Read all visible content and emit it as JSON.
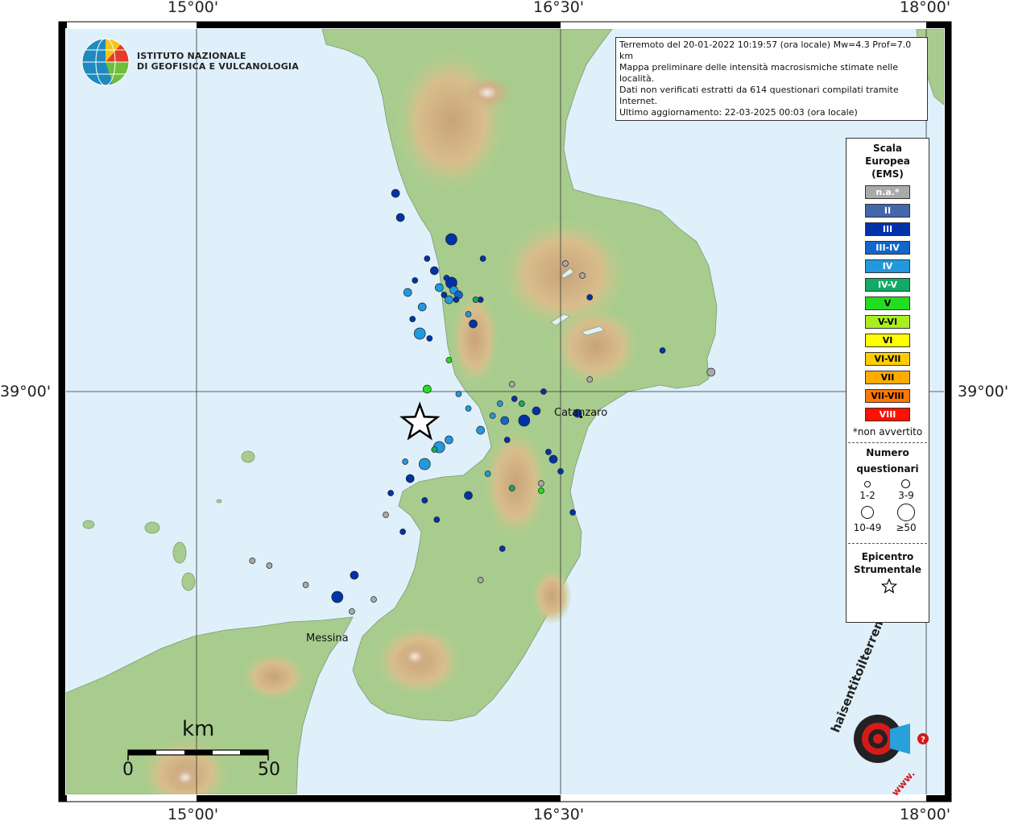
{
  "coords": {
    "top": [
      "15°00'",
      "16°30'",
      "18°00'"
    ],
    "bottom": [
      "15°00'",
      "16°30'",
      "18°00'"
    ],
    "left": "39°00'",
    "right": "39°00'"
  },
  "logo": {
    "line1": "ISTITUTO NAZIONALE",
    "line2": "DI GEOFISICA E VULCANOLOGIA"
  },
  "info": {
    "line1": "Terremoto del 20-01-2022 10:19:57 (ora locale) Mw=4.3 Prof=7.0 km",
    "line2": "Mappa preliminare delle intensità macrosismiche stimate nelle località.",
    "line3": "Dati non verificati estratti da 614 questionari compilati tramite Internet.",
    "line4": "Ultimo aggiornamento: 22-03-2025 00:03 (ora locale)"
  },
  "places": {
    "catanzaro": "Catanzaro",
    "messina": "Messina"
  },
  "legend": {
    "title1": "Scala",
    "title2": "Europea",
    "title3": "(EMS)",
    "scale": [
      {
        "label": "n.a.*",
        "color": "#aaaaaa",
        "text": "#ffffff"
      },
      {
        "label": "II",
        "color": "#4466aa",
        "text": "#ffffff"
      },
      {
        "label": "III",
        "color": "#0033aa",
        "text": "#ffffff"
      },
      {
        "label": "III-IV",
        "color": "#1166cc",
        "text": "#ffffff"
      },
      {
        "label": "IV",
        "color": "#2299dd",
        "text": "#ffffff"
      },
      {
        "label": "IV-V",
        "color": "#11aa66",
        "text": "#ffffff"
      },
      {
        "label": "V",
        "color": "#22dd22",
        "text": "#000000"
      },
      {
        "label": "V-VI",
        "color": "#aaee22",
        "text": "#000000"
      },
      {
        "label": "VI",
        "color": "#ffff00",
        "text": "#000000"
      },
      {
        "label": "VI-VII",
        "color": "#ffcc00",
        "text": "#000000"
      },
      {
        "label": "VII",
        "color": "#ffaa00",
        "text": "#000000"
      },
      {
        "label": "VII-VIII",
        "color": "#ff7700",
        "text": "#000000"
      },
      {
        "label": "VIII",
        "color": "#ff1100",
        "text": "#ffffff"
      }
    ],
    "note": "*non avvertito",
    "count_title1": "Numero",
    "count_title2": "questionari",
    "sizes": [
      "1-2",
      "3-9",
      "10-49",
      "≥50"
    ],
    "epi1": "Epicentro",
    "epi2": "Strumentale"
  },
  "scalebar": {
    "unit": "km",
    "min": "0",
    "max": "50"
  },
  "badge": {
    "text": "haisentitoilterremoto.it",
    "url": "www."
  },
  "colors": {
    "sea": "#dff0fa",
    "land": "#9fc88a",
    "mountain": "#c8a878",
    "frame": "#000000"
  },
  "points": [
    {
      "lon": 16.0,
      "lat": 39.43,
      "level": "IV",
      "n": "3-9"
    },
    {
      "lon": 16.05,
      "lat": 39.45,
      "level": "III",
      "n": "10-49"
    },
    {
      "lon": 16.02,
      "lat": 39.4,
      "level": "III",
      "n": "1-2"
    },
    {
      "lon": 16.06,
      "lat": 39.42,
      "level": "IV",
      "n": "3-9"
    },
    {
      "lon": 16.08,
      "lat": 39.4,
      "level": "III-IV",
      "n": "3-9"
    },
    {
      "lon": 16.04,
      "lat": 39.38,
      "level": "IV",
      "n": "3-9"
    },
    {
      "lon": 16.07,
      "lat": 39.38,
      "level": "III",
      "n": "1-2"
    },
    {
      "lon": 16.03,
      "lat": 39.47,
      "level": "III",
      "n": "1-2"
    },
    {
      "lon": 15.98,
      "lat": 39.5,
      "level": "III",
      "n": "3-9"
    },
    {
      "lon": 15.9,
      "lat": 39.46,
      "level": "III",
      "n": "1-2"
    },
    {
      "lon": 15.87,
      "lat": 39.41,
      "level": "IV",
      "n": "3-9"
    },
    {
      "lon": 15.89,
      "lat": 39.3,
      "level": "III",
      "n": "1-2"
    },
    {
      "lon": 15.93,
      "lat": 39.35,
      "level": "IV",
      "n": "3-9"
    },
    {
      "lon": 15.96,
      "lat": 39.22,
      "level": "III",
      "n": "1-2"
    },
    {
      "lon": 15.92,
      "lat": 39.24,
      "level": "IV",
      "n": "10-49"
    },
    {
      "lon": 16.14,
      "lat": 39.28,
      "level": "III",
      "n": "3-9"
    },
    {
      "lon": 16.12,
      "lat": 39.32,
      "level": "IV",
      "n": "1-2"
    },
    {
      "lon": 16.17,
      "lat": 39.38,
      "level": "III",
      "n": "1-2"
    },
    {
      "lon": 15.84,
      "lat": 39.72,
      "level": "III",
      "n": "3-9"
    },
    {
      "lon": 15.82,
      "lat": 39.82,
      "level": "III",
      "n": "3-9"
    },
    {
      "lon": 16.05,
      "lat": 39.63,
      "level": "III",
      "n": "10-49"
    },
    {
      "lon": 15.95,
      "lat": 39.55,
      "level": "III",
      "n": "1-2"
    },
    {
      "lon": 16.18,
      "lat": 39.55,
      "level": "III",
      "n": "1-2"
    },
    {
      "lon": 16.62,
      "lat": 39.39,
      "level": "III",
      "n": "1-2"
    },
    {
      "lon": 16.92,
      "lat": 39.17,
      "level": "III",
      "n": "1-2"
    },
    {
      "lon": 16.3,
      "lat": 39.03,
      "level": "n.a.*",
      "n": "1-2"
    },
    {
      "lon": 16.43,
      "lat": 39.0,
      "level": "III",
      "n": "1-2"
    },
    {
      "lon": 16.31,
      "lat": 38.97,
      "level": "III",
      "n": "1-2"
    },
    {
      "lon": 16.25,
      "lat": 38.95,
      "level": "IV",
      "n": "1-2"
    },
    {
      "lon": 16.4,
      "lat": 38.92,
      "level": "III",
      "n": "3-9"
    },
    {
      "lon": 16.35,
      "lat": 38.88,
      "level": "III",
      "n": "10-49"
    },
    {
      "lon": 16.27,
      "lat": 38.88,
      "level": "III-IV",
      "n": "3-9"
    },
    {
      "lon": 16.22,
      "lat": 38.9,
      "level": "IV",
      "n": "1-2"
    },
    {
      "lon": 16.12,
      "lat": 38.93,
      "level": "IV",
      "n": "1-2"
    },
    {
      "lon": 16.08,
      "lat": 38.99,
      "level": "IV",
      "n": "1-2"
    },
    {
      "lon": 16.17,
      "lat": 38.84,
      "level": "IV",
      "n": "3-9"
    },
    {
      "lon": 16.28,
      "lat": 38.8,
      "level": "III",
      "n": "1-2"
    },
    {
      "lon": 16.04,
      "lat": 38.8,
      "level": "IV",
      "n": "3-9"
    },
    {
      "lon": 16.0,
      "lat": 38.77,
      "level": "IV",
      "n": "10-49"
    },
    {
      "lon": 15.94,
      "lat": 38.7,
      "level": "IV",
      "n": "10-49"
    },
    {
      "lon": 15.86,
      "lat": 38.71,
      "level": "IV",
      "n": "1-2"
    },
    {
      "lon": 15.88,
      "lat": 38.64,
      "level": "III",
      "n": "3-9"
    },
    {
      "lon": 15.8,
      "lat": 38.58,
      "level": "III",
      "n": "1-2"
    },
    {
      "lon": 15.94,
      "lat": 38.55,
      "level": "III",
      "n": "1-2"
    },
    {
      "lon": 15.99,
      "lat": 38.47,
      "level": "III",
      "n": "1-2"
    },
    {
      "lon": 16.12,
      "lat": 38.57,
      "level": "III",
      "n": "3-9"
    },
    {
      "lon": 16.2,
      "lat": 38.66,
      "level": "IV",
      "n": "1-2"
    },
    {
      "lon": 16.45,
      "lat": 38.75,
      "level": "III",
      "n": "1-2"
    },
    {
      "lon": 16.57,
      "lat": 38.91,
      "level": "III",
      "n": "3-9"
    },
    {
      "lon": 16.5,
      "lat": 38.67,
      "level": "III",
      "n": "1-2"
    },
    {
      "lon": 16.55,
      "lat": 38.5,
      "level": "III",
      "n": "1-2"
    },
    {
      "lon": 16.47,
      "lat": 38.72,
      "level": "III",
      "n": "3-9"
    },
    {
      "lon": 15.65,
      "lat": 38.24,
      "level": "III",
      "n": "3-9"
    },
    {
      "lon": 15.58,
      "lat": 38.15,
      "level": "III",
      "n": "10-49"
    },
    {
      "lon": 15.73,
      "lat": 38.14,
      "level": "n.a.*",
      "n": "1-2"
    },
    {
      "lon": 15.64,
      "lat": 38.09,
      "level": "n.a.*",
      "n": "1-2"
    },
    {
      "lon": 15.85,
      "lat": 38.42,
      "level": "III",
      "n": "1-2"
    },
    {
      "lon": 15.78,
      "lat": 38.49,
      "level": "n.a.*",
      "n": "1-2"
    },
    {
      "lon": 16.26,
      "lat": 38.35,
      "level": "III",
      "n": "1-2"
    },
    {
      "lon": 16.17,
      "lat": 38.22,
      "level": "n.a.*",
      "n": "1-2"
    },
    {
      "lon": 15.3,
      "lat": 38.28,
      "level": "n.a.*",
      "n": "1-2"
    },
    {
      "lon": 15.45,
      "lat": 38.2,
      "level": "n.a.*",
      "n": "1-2"
    },
    {
      "lon": 15.23,
      "lat": 38.3,
      "level": "n.a.*",
      "n": "1-2"
    },
    {
      "lon": 15.98,
      "lat": 38.76,
      "level": "IV-V",
      "n": "1-2"
    },
    {
      "lon": 16.3,
      "lat": 38.6,
      "level": "IV-V",
      "n": "1-2"
    },
    {
      "lon": 16.42,
      "lat": 38.59,
      "level": "V",
      "n": "1-2"
    },
    {
      "lon": 15.95,
      "lat": 39.01,
      "level": "V",
      "n": "3-9"
    },
    {
      "lon": 16.04,
      "lat": 39.13,
      "level": "V",
      "n": "1-2"
    },
    {
      "lon": 16.15,
      "lat": 39.38,
      "level": "IV-V",
      "n": "1-2"
    },
    {
      "lon": 16.52,
      "lat": 39.53,
      "level": "n.a.*",
      "n": "1-2"
    },
    {
      "lon": 16.59,
      "lat": 39.48,
      "level": "n.a.*",
      "n": "1-2"
    },
    {
      "lon": 16.62,
      "lat": 39.05,
      "level": "n.a.*",
      "n": "1-2"
    },
    {
      "lon": 17.12,
      "lat": 39.08,
      "level": "n.a.*",
      "n": "3-9"
    },
    {
      "lon": 16.34,
      "lat": 38.95,
      "level": "IV-V",
      "n": "1-2"
    },
    {
      "lon": 16.42,
      "lat": 38.62,
      "level": "n.a.*",
      "n": "1-2"
    }
  ],
  "epicenter": {
    "lon": 15.92,
    "lat": 38.87
  }
}
